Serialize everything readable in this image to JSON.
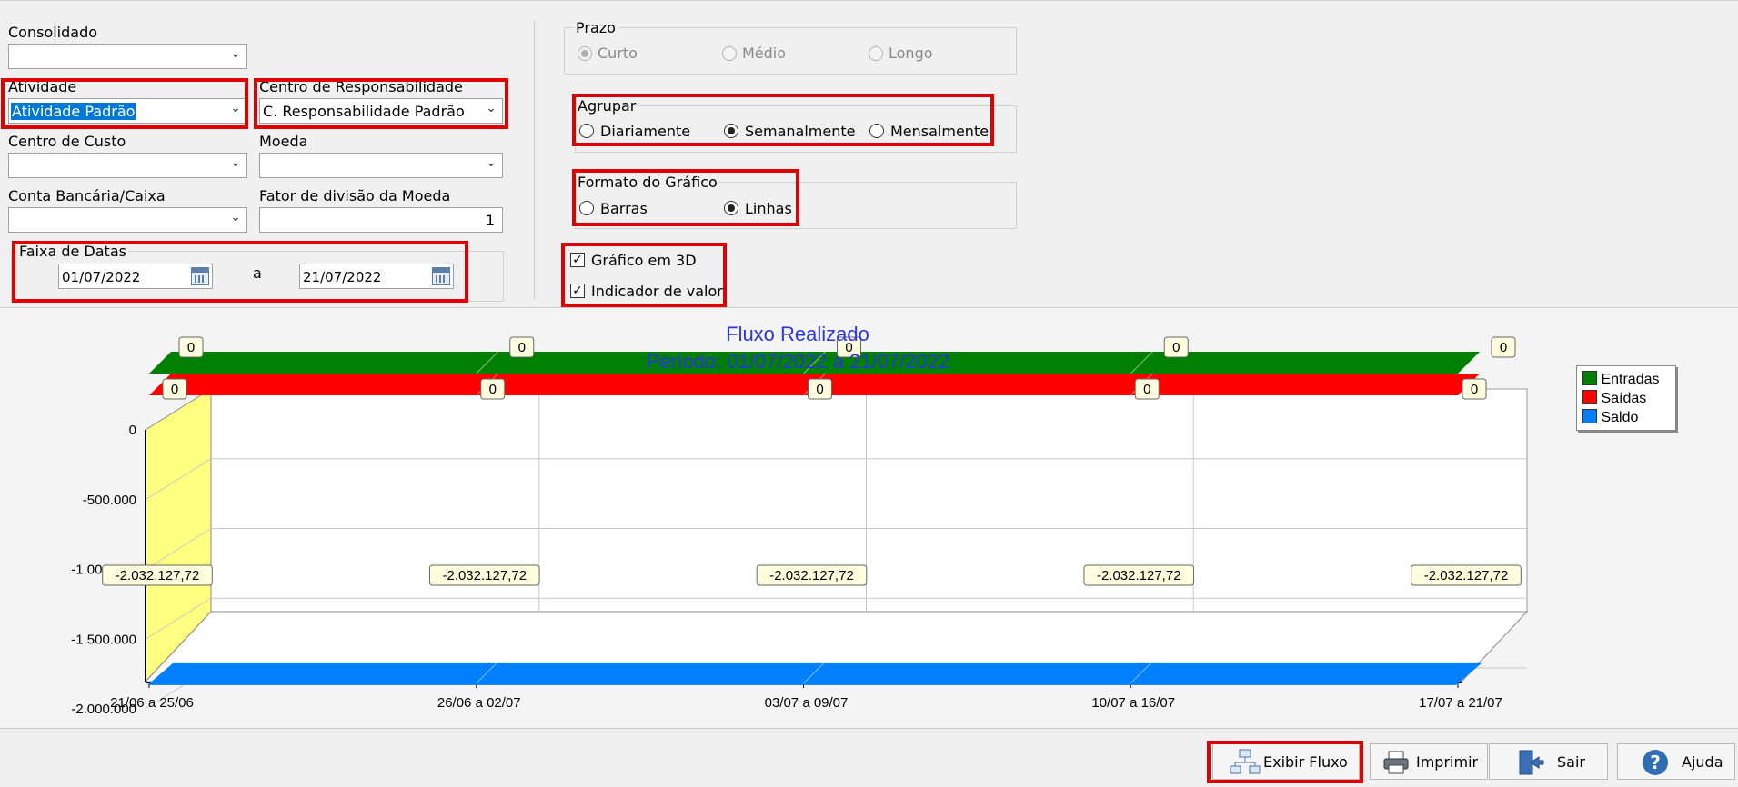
{
  "filters": {
    "consolidado": {
      "label": "Consolidado",
      "value": ""
    },
    "atividade": {
      "label": "Atividade",
      "value": "Atividade Padrão"
    },
    "centro_responsabilidade": {
      "label": "Centro de Responsabilidade",
      "value": "C. Responsabilidade Padrão"
    },
    "centro_custo": {
      "label": "Centro de Custo",
      "value": ""
    },
    "moeda": {
      "label": "Moeda",
      "value": ""
    },
    "conta_bancaria": {
      "label": "Conta Bancária/Caixa",
      "value": ""
    },
    "fator_divisao": {
      "label": "Fator de divisão da Moeda",
      "value": "1"
    },
    "faixa_datas": {
      "label": "Faixa de Datas",
      "start": "01/07/2022",
      "separator": "a",
      "end": "21/07/2022"
    }
  },
  "options": {
    "prazo": {
      "title": "Prazo",
      "items": [
        "Curto",
        "Médio",
        "Longo"
      ],
      "selected": "Curto",
      "disabled": true
    },
    "agrupar": {
      "title": "Agrupar",
      "items": [
        "Diariamente",
        "Semanalmente",
        "Mensalmente"
      ],
      "selected": "Semanalmente"
    },
    "formato": {
      "title": "Formato do Gráfico",
      "items": [
        "Barras",
        "Linhas"
      ],
      "selected": "Linhas"
    },
    "grafico_3d": {
      "label": "Gráfico em 3D",
      "checked": true
    },
    "indicador_valor": {
      "label": "Indicador de valor",
      "checked": true
    }
  },
  "chart_data": {
    "type": "line",
    "title": "Fluxo Realizado",
    "subtitle": "Período: 01/07/2022 a 21/07/2022",
    "categories": [
      "21/06 a 25/06",
      "26/06 a 02/07",
      "03/07 a 09/07",
      "10/07 a 16/07",
      "17/07 a 21/07"
    ],
    "series": [
      {
        "name": "Entradas",
        "color": "#008000",
        "values": [
          0,
          0,
          0,
          0,
          0
        ],
        "labels": [
          "0",
          "0",
          "0",
          "0",
          "0"
        ]
      },
      {
        "name": "Saídas",
        "color": "#ff0000",
        "values": [
          0,
          0,
          0,
          0,
          0
        ],
        "labels": [
          "0",
          "0",
          "0",
          "0",
          "0"
        ]
      },
      {
        "name": "Saldo",
        "color": "#0080ff",
        "values": [
          -2032127.72,
          -2032127.72,
          -2032127.72,
          -2032127.72,
          -2032127.72
        ],
        "labels": [
          "-2.032.127,72",
          "-2.032.127,72",
          "-2.032.127,72",
          "-2.032.127,72",
          "-2.032.127,72"
        ]
      }
    ],
    "yticks": [
      "0",
      "-500.000",
      "-1.000.000",
      "-1.500.000",
      "-2.000.000"
    ],
    "ylim": [
      -2000000,
      0
    ],
    "three_d": true,
    "grid": true,
    "legend_position": "right"
  },
  "buttons": {
    "exibir": "Exibir Fluxo",
    "imprimir": "Imprimir",
    "sair": "Sair",
    "ajuda": "Ajuda"
  }
}
